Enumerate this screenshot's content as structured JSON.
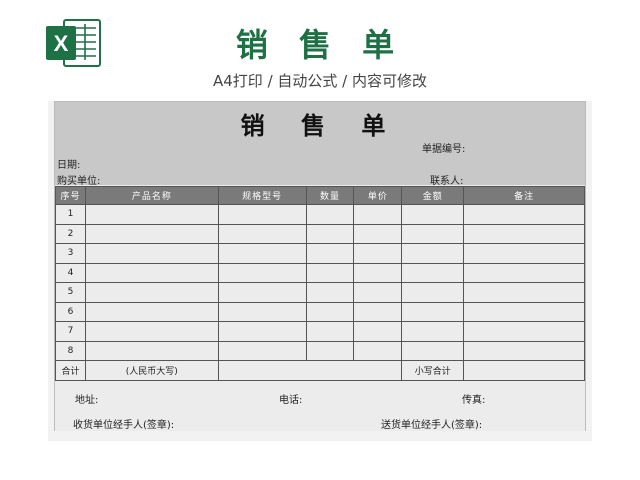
{
  "header": {
    "title": "销 售 单",
    "subtitle": "A4打印 / 自动公式 / 内容可修改",
    "icon": "excel-icon",
    "brand_color": "#1e7145"
  },
  "form": {
    "title": "销 售 单",
    "doc_no_label": "单据编号:",
    "date_label": "日期:",
    "buyer_label": "购买单位:",
    "contact_label": "联系人:",
    "columns": [
      "序号",
      "产品名称",
      "规格型号",
      "数量",
      "单价",
      "金额",
      "备注"
    ],
    "rows": [
      "1",
      "2",
      "3",
      "4",
      "5",
      "6",
      "7",
      "8"
    ],
    "total_label": "合计",
    "rmb_label": "(人民币大写)",
    "subtotal_label": "小写合计",
    "address_label": "地址:",
    "phone_label": "电话:",
    "fax_label": "传真:",
    "receiver_label": "收货单位经手人(签章):",
    "sender_label": "送货单位经手人(签章):"
  }
}
